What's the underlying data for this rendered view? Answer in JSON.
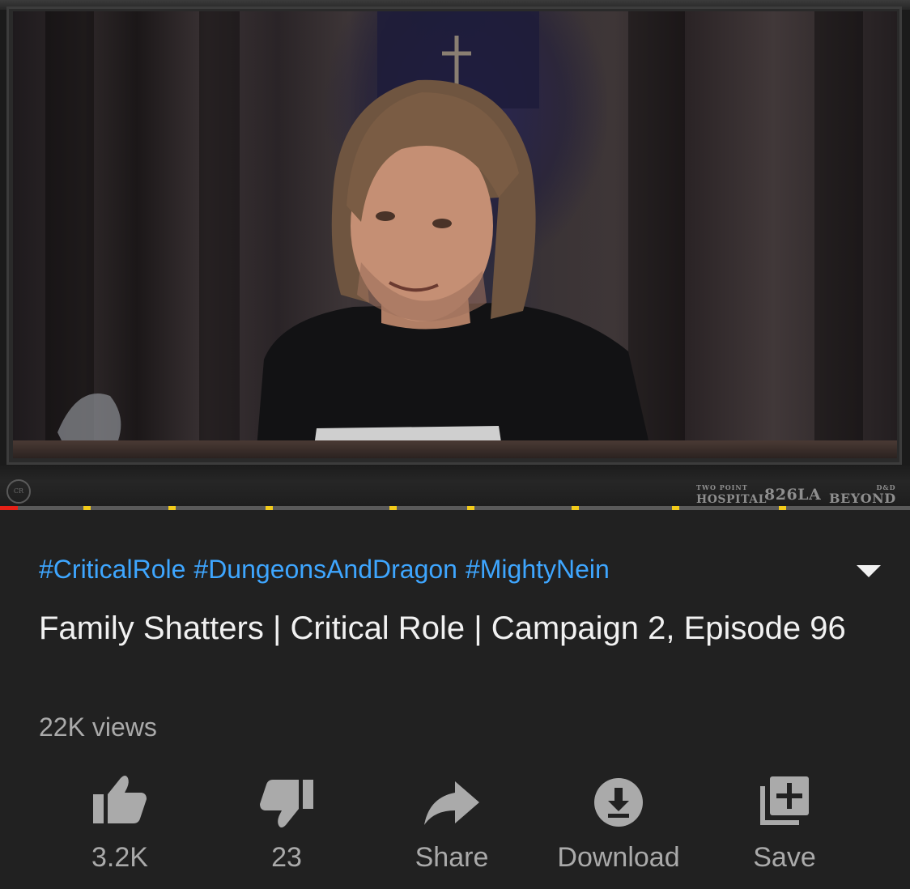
{
  "player": {
    "sponsors": {
      "two_point_small": "TWO POINT",
      "two_point_main": "HOSPITAL",
      "studio": "826LA",
      "dnd_small": "D&D",
      "dnd_main": "BEYOND"
    },
    "logo_text": "Critical Role",
    "progress_fraction": 0.02,
    "chapter_marker_count": 9,
    "colors": {
      "progress": "#e62117",
      "markers": "#f2cb1a",
      "track": "#5a5a5a"
    }
  },
  "video": {
    "hashtags": [
      "#CriticalRole",
      "#DungeonsAndDragon",
      "#MightyNein"
    ],
    "title": "Family Shatters | Critical Role | Campaign 2, Episode 96",
    "views": "22K views"
  },
  "actions": {
    "like": {
      "label": "3.2K",
      "icon": "thumbs-up-icon"
    },
    "dislike": {
      "label": "23",
      "icon": "thumbs-down-icon"
    },
    "share": {
      "label": "Share",
      "icon": "share-arrow-icon"
    },
    "download": {
      "label": "Download",
      "icon": "download-icon"
    },
    "save": {
      "label": "Save",
      "icon": "playlist-add-icon"
    }
  },
  "colors": {
    "background": "#212121",
    "hashtag": "#3ea6ff",
    "title": "#f1f1f1",
    "secondary": "#aaaaaa"
  }
}
